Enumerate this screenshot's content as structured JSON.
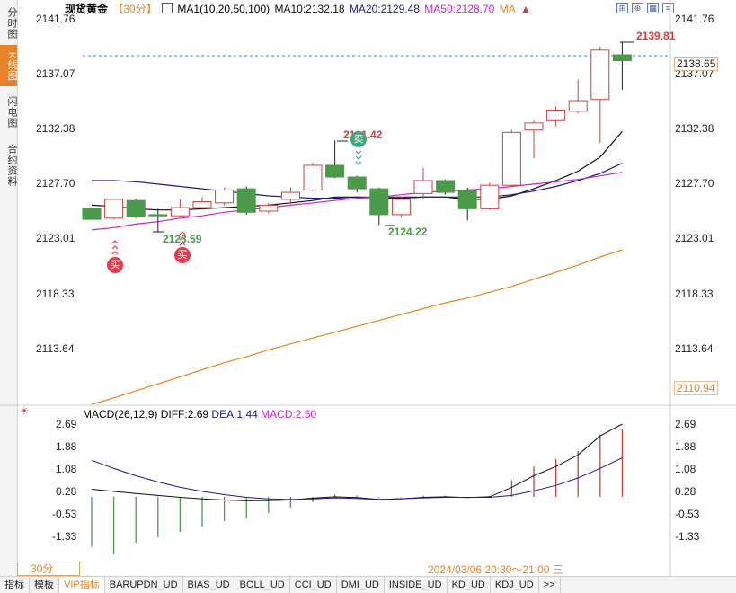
{
  "sidebar": {
    "tabs": [
      "分时图",
      "K线图",
      "闪电图",
      "合约资料"
    ],
    "active": 1
  },
  "header": {
    "symbol": "现货黄金",
    "period": "【30分】",
    "ma_label": "MA1(10,20,50,100)",
    "ma10": "MA10:2132.18",
    "ma20": "MA20:2129.48",
    "ma50": "MA50:2128.70",
    "ma100": "MA"
  },
  "price_axis": {
    "ticks": [
      "2141.76",
      "2137.07",
      "2132.38",
      "2127.70",
      "2123.01",
      "2118.33",
      "2113.64"
    ],
    "min": 2108.96,
    "max": 2141.76,
    "current_tag": "2138.65",
    "ma100_tag": "2110.94"
  },
  "annotations": {
    "high": "2139.81",
    "low": "2124.22",
    "low_left": "2123.59",
    "peak_mid": "2131.42",
    "buy": "买",
    "sell": "卖"
  },
  "macd": {
    "label": "MACD(26,12,9)",
    "diff": "DIFF:2.69",
    "dea": "DEA:1.44",
    "macd_val": "MACD:2.50",
    "ticks": [
      "2.69",
      "1.88",
      "1.08",
      "0.28",
      "-0.53",
      "-1.33"
    ],
    "min": -2.13,
    "max": 2.69
  },
  "colors": {
    "up": "#d24040",
    "down": "#4a9a4a",
    "ma10": "#111111",
    "ma20": "#1a1a8a",
    "ma50": "#cc22cc",
    "ma100": "#e8831a",
    "accent": "#e8832a"
  },
  "footer": {
    "period": "30分",
    "date_range": "2024/03/06 20:30～21:00 三",
    "tabs": [
      "指标",
      "模板",
      "VIP指标",
      "BARUPDN_UD",
      "BIAS_UD",
      "BOLL_UD",
      "CCI_UD",
      "DMI_UD",
      "INSIDE_UD",
      "KD_UD",
      "KDJ_UD",
      ">>"
    ],
    "active": 2
  },
  "chart_data": [
    {
      "type": "candlestick",
      "title": "现货黄金 【30分】",
      "ylim": [
        2108.96,
        2141.76
      ],
      "candles": [
        {
          "o": 2125.6,
          "c": 2124.7,
          "h": 2125.6,
          "l": 2124.7
        },
        {
          "o": 2124.8,
          "c": 2126.4,
          "h": 2126.4,
          "l": 2124.7
        },
        {
          "o": 2126.3,
          "c": 2124.9,
          "h": 2126.4,
          "l": 2124.8
        },
        {
          "o": 2125.1,
          "c": 2125.0,
          "h": 2125.6,
          "l": 2123.59
        },
        {
          "o": 2125.0,
          "c": 2125.7,
          "h": 2126.4,
          "l": 2124.9
        },
        {
          "o": 2125.7,
          "c": 2126.2,
          "h": 2126.6,
          "l": 2125.5
        },
        {
          "o": 2126.1,
          "c": 2127.2,
          "h": 2127.4,
          "l": 2125.9
        },
        {
          "o": 2127.3,
          "c": 2125.3,
          "h": 2127.5,
          "l": 2125.1
        },
        {
          "o": 2125.4,
          "c": 2125.9,
          "h": 2126.1,
          "l": 2125.2
        },
        {
          "o": 2126.4,
          "c": 2127.0,
          "h": 2127.4,
          "l": 2126.0
        },
        {
          "o": 2127.2,
          "c": 2129.3,
          "h": 2129.5,
          "l": 2127.1
        },
        {
          "o": 2129.3,
          "c": 2128.3,
          "h": 2131.42,
          "l": 2128.2
        },
        {
          "o": 2128.3,
          "c": 2127.3,
          "h": 2128.4,
          "l": 2127.0
        },
        {
          "o": 2127.3,
          "c": 2125.1,
          "h": 2127.4,
          "l": 2124.22
        },
        {
          "o": 2125.1,
          "c": 2126.4,
          "h": 2126.6,
          "l": 2124.9
        },
        {
          "o": 2126.9,
          "c": 2128.0,
          "h": 2129.1,
          "l": 2126.4
        },
        {
          "o": 2128.0,
          "c": 2127.0,
          "h": 2128.1,
          "l": 2126.8
        },
        {
          "o": 2127.2,
          "c": 2125.6,
          "h": 2127.4,
          "l": 2124.6
        },
        {
          "o": 2125.6,
          "c": 2127.6,
          "h": 2127.8,
          "l": 2125.5
        },
        {
          "o": 2127.6,
          "c": 2132.1,
          "h": 2132.3,
          "l": 2127.5
        },
        {
          "o": 2132.3,
          "c": 2132.9,
          "h": 2133.1,
          "l": 2129.9
        },
        {
          "o": 2133.1,
          "c": 2134.0,
          "h": 2134.3,
          "l": 2132.6
        },
        {
          "o": 2133.9,
          "c": 2134.8,
          "h": 2136.6,
          "l": 2133.7
        },
        {
          "o": 2134.9,
          "c": 2139.1,
          "h": 2139.4,
          "l": 2131.2
        },
        {
          "o": 2138.7,
          "c": 2138.2,
          "h": 2139.81,
          "l": 2135.7
        }
      ],
      "series": [
        {
          "name": "MA10",
          "values": [
            2125.9,
            2125.8,
            2125.6,
            2125.5,
            2125.5,
            2125.6,
            2125.7,
            2125.8,
            2125.9,
            2126.1,
            2126.3,
            2126.6,
            2126.6,
            2126.5,
            2126.5,
            2126.6,
            2126.6,
            2126.4,
            2126.4,
            2126.7,
            2127.3,
            2128.0,
            2128.8,
            2130.0,
            2132.18
          ]
        },
        {
          "name": "MA20",
          "values": [
            2128.0,
            2128.0,
            2127.9,
            2127.7,
            2127.5,
            2127.3,
            2127.1,
            2126.9,
            2126.7,
            2126.6,
            2126.5,
            2126.5,
            2126.6,
            2126.6,
            2126.6,
            2126.6,
            2126.6,
            2126.6,
            2126.6,
            2126.8,
            2127.1,
            2127.5,
            2128.0,
            2128.6,
            2129.48
          ]
        },
        {
          "name": "MA50",
          "values": [
            2123.8,
            2124.0,
            2124.3,
            2124.5,
            2124.8,
            2125.0,
            2125.3,
            2125.5,
            2125.7,
            2125.9,
            2126.1,
            2126.3,
            2126.5,
            2126.6,
            2126.8,
            2127.0,
            2127.1,
            2127.2,
            2127.3,
            2127.5,
            2127.7,
            2127.9,
            2128.1,
            2128.4,
            2128.7
          ]
        },
        {
          "name": "MA100",
          "values": [
            2108.96,
            2109.5,
            2110.1,
            2110.7,
            2111.3,
            2111.9,
            2112.5,
            2113.0,
            2113.6,
            2114.1,
            2114.6,
            2115.1,
            2115.6,
            2116.1,
            2116.6,
            2117.1,
            2117.6,
            2118.0,
            2118.5,
            2119.0,
            2119.6,
            2120.2,
            2120.8,
            2121.5,
            2122.1
          ]
        }
      ]
    },
    {
      "type": "bar",
      "title": "MACD(26,12,9)",
      "ylim": [
        -2.13,
        2.69
      ],
      "series": [
        {
          "name": "DIFF",
          "values": [
            0.28,
            0.2,
            0.12,
            0.05,
            -0.02,
            -0.08,
            -0.12,
            -0.15,
            -0.14,
            -0.12,
            -0.05,
            0.0,
            -0.03,
            -0.1,
            -0.08,
            -0.02,
            0.0,
            -0.03,
            0.0,
            0.35,
            0.78,
            1.12,
            1.55,
            2.25,
            2.69
          ]
        },
        {
          "name": "DEA",
          "values": [
            1.35,
            1.05,
            0.78,
            0.55,
            0.35,
            0.2,
            0.08,
            -0.02,
            -0.08,
            -0.1,
            -0.08,
            -0.04,
            -0.06,
            -0.1,
            -0.07,
            -0.04,
            -0.02,
            -0.02,
            -0.02,
            0.05,
            0.22,
            0.42,
            0.7,
            1.05,
            1.44
          ]
        },
        {
          "name": "MACD",
          "values": [
            -1.85,
            -2.13,
            -1.7,
            -1.5,
            -1.3,
            -1.1,
            -0.9,
            -0.8,
            -0.6,
            -0.4,
            -0.2,
            0.08,
            0.05,
            -0.05,
            -0.02,
            0.04,
            0.04,
            -0.02,
            0.04,
            0.6,
            1.12,
            1.4,
            1.7,
            2.3,
            2.5
          ]
        }
      ]
    }
  ]
}
